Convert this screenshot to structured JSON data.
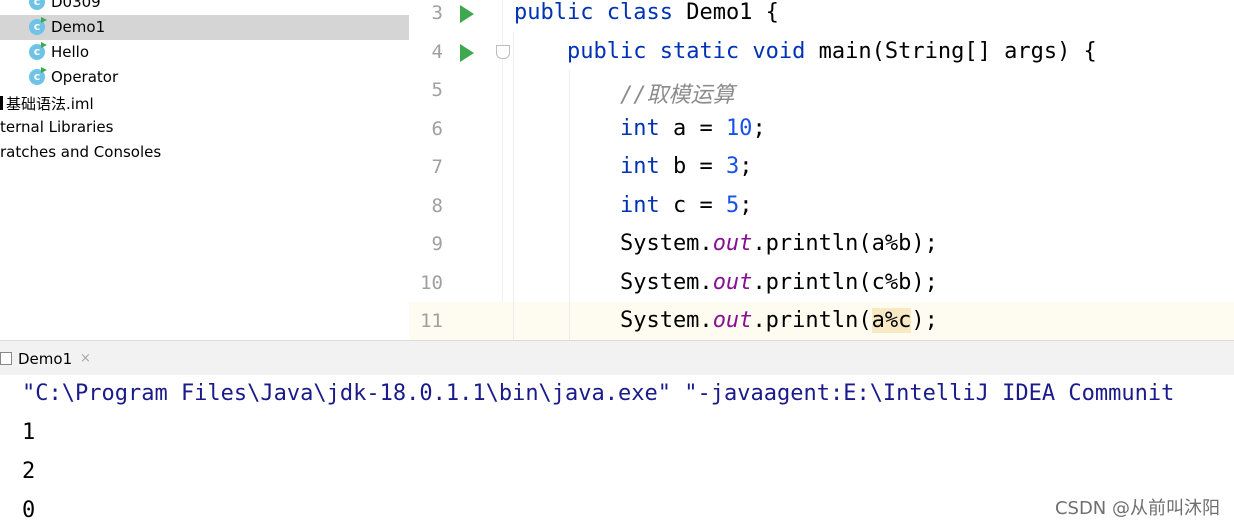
{
  "project_tree": {
    "items": [
      {
        "label": "D0309",
        "type": "class"
      },
      {
        "label": "Demo1",
        "type": "class",
        "selected": true
      },
      {
        "label": "Hello",
        "type": "class"
      },
      {
        "label": "Operator",
        "type": "class"
      },
      {
        "label": "基础语法.iml",
        "type": "file"
      },
      {
        "label": "ternal Libraries",
        "type": "folder"
      },
      {
        "label": "ratches and Consoles",
        "type": "folder"
      }
    ],
    "class_icon_glyph": "c"
  },
  "editor": {
    "current_line": 11,
    "lines": [
      {
        "num": "3",
        "run": true,
        "tokens": [
          {
            "t": "public ",
            "c": "kw"
          },
          {
            "t": "class ",
            "c": "kw"
          },
          {
            "t": "Demo1 {",
            "c": ""
          }
        ]
      },
      {
        "num": "4",
        "run": true,
        "tokens": [
          {
            "t": "    ",
            "c": ""
          },
          {
            "t": "public ",
            "c": "kw"
          },
          {
            "t": "static ",
            "c": "kw"
          },
          {
            "t": "void ",
            "c": "kw"
          },
          {
            "t": "main(String[] args) {",
            "c": ""
          }
        ]
      },
      {
        "num": "5",
        "run": false,
        "tokens": [
          {
            "t": "        ",
            "c": ""
          },
          {
            "t": "//取模运算",
            "c": "cmt"
          }
        ]
      },
      {
        "num": "6",
        "run": false,
        "tokens": [
          {
            "t": "        ",
            "c": ""
          },
          {
            "t": "int ",
            "c": "kw"
          },
          {
            "t": "a = ",
            "c": ""
          },
          {
            "t": "10",
            "c": "num"
          },
          {
            "t": ";",
            "c": ""
          }
        ]
      },
      {
        "num": "7",
        "run": false,
        "tokens": [
          {
            "t": "        ",
            "c": ""
          },
          {
            "t": "int ",
            "c": "kw"
          },
          {
            "t": "b = ",
            "c": ""
          },
          {
            "t": "3",
            "c": "num"
          },
          {
            "t": ";",
            "c": ""
          }
        ]
      },
      {
        "num": "8",
        "run": false,
        "tokens": [
          {
            "t": "        ",
            "c": ""
          },
          {
            "t": "int ",
            "c": "kw"
          },
          {
            "t": "c = ",
            "c": ""
          },
          {
            "t": "5",
            "c": "num"
          },
          {
            "t": ";",
            "c": ""
          }
        ]
      },
      {
        "num": "9",
        "run": false,
        "tokens": [
          {
            "t": "        System.",
            "c": ""
          },
          {
            "t": "out",
            "c": "fld"
          },
          {
            "t": ".println(a%b);",
            "c": ""
          }
        ]
      },
      {
        "num": "10",
        "run": false,
        "tokens": [
          {
            "t": "        System.",
            "c": ""
          },
          {
            "t": "out",
            "c": "fld"
          },
          {
            "t": ".println(c%b);",
            "c": ""
          }
        ]
      },
      {
        "num": "11",
        "run": false,
        "tokens": [
          {
            "t": "        System.",
            "c": ""
          },
          {
            "t": "out",
            "c": "fld"
          },
          {
            "t": ".println(",
            "c": ""
          },
          {
            "t": "a%c",
            "c": "hl"
          },
          {
            "t": ");",
            "c": ""
          }
        ]
      }
    ]
  },
  "run_panel": {
    "tab_label": "Demo1",
    "tab_close": "×",
    "command": "\"C:\\Program Files\\Java\\jdk-18.0.1.1\\bin\\java.exe\" \"-javaagent:E:\\IntelliJ IDEA Communit",
    "output": [
      "1",
      "2",
      "0"
    ]
  },
  "watermark": "CSDN @从前叫沐阳",
  "colors": {
    "keyword": "#0033b3",
    "number": "#1750eb",
    "comment": "#8c8c8c",
    "field": "#871094",
    "run_green": "#3ea84e",
    "class_icon": "#6ec3e6",
    "selection": "#d5d5d5",
    "current_line": "#fefcf0"
  }
}
